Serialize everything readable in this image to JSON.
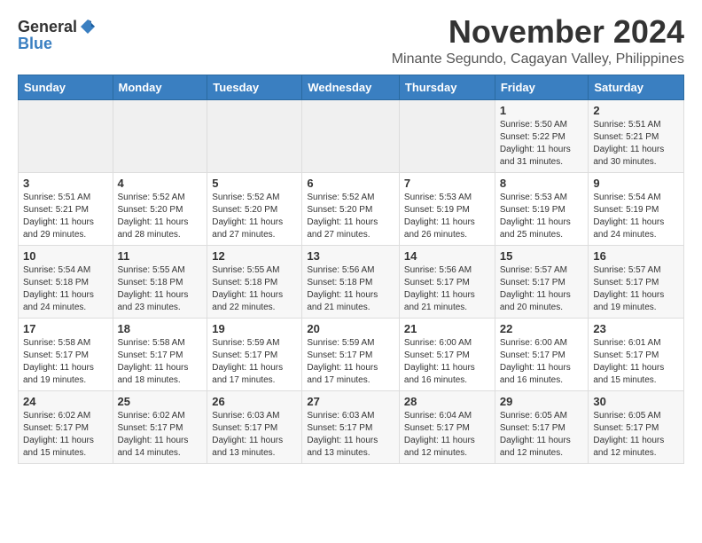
{
  "header": {
    "logo_general": "General",
    "logo_blue": "Blue",
    "month": "November 2024",
    "location": "Minante Segundo, Cagayan Valley, Philippines"
  },
  "weekdays": [
    "Sunday",
    "Monday",
    "Tuesday",
    "Wednesday",
    "Thursday",
    "Friday",
    "Saturday"
  ],
  "weeks": [
    [
      {
        "day": "",
        "info": ""
      },
      {
        "day": "",
        "info": ""
      },
      {
        "day": "",
        "info": ""
      },
      {
        "day": "",
        "info": ""
      },
      {
        "day": "",
        "info": ""
      },
      {
        "day": "1",
        "info": "Sunrise: 5:50 AM\nSunset: 5:22 PM\nDaylight: 11 hours\nand 31 minutes."
      },
      {
        "day": "2",
        "info": "Sunrise: 5:51 AM\nSunset: 5:21 PM\nDaylight: 11 hours\nand 30 minutes."
      }
    ],
    [
      {
        "day": "3",
        "info": "Sunrise: 5:51 AM\nSunset: 5:21 PM\nDaylight: 11 hours\nand 29 minutes."
      },
      {
        "day": "4",
        "info": "Sunrise: 5:52 AM\nSunset: 5:20 PM\nDaylight: 11 hours\nand 28 minutes."
      },
      {
        "day": "5",
        "info": "Sunrise: 5:52 AM\nSunset: 5:20 PM\nDaylight: 11 hours\nand 27 minutes."
      },
      {
        "day": "6",
        "info": "Sunrise: 5:52 AM\nSunset: 5:20 PM\nDaylight: 11 hours\nand 27 minutes."
      },
      {
        "day": "7",
        "info": "Sunrise: 5:53 AM\nSunset: 5:19 PM\nDaylight: 11 hours\nand 26 minutes."
      },
      {
        "day": "8",
        "info": "Sunrise: 5:53 AM\nSunset: 5:19 PM\nDaylight: 11 hours\nand 25 minutes."
      },
      {
        "day": "9",
        "info": "Sunrise: 5:54 AM\nSunset: 5:19 PM\nDaylight: 11 hours\nand 24 minutes."
      }
    ],
    [
      {
        "day": "10",
        "info": "Sunrise: 5:54 AM\nSunset: 5:18 PM\nDaylight: 11 hours\nand 24 minutes."
      },
      {
        "day": "11",
        "info": "Sunrise: 5:55 AM\nSunset: 5:18 PM\nDaylight: 11 hours\nand 23 minutes."
      },
      {
        "day": "12",
        "info": "Sunrise: 5:55 AM\nSunset: 5:18 PM\nDaylight: 11 hours\nand 22 minutes."
      },
      {
        "day": "13",
        "info": "Sunrise: 5:56 AM\nSunset: 5:18 PM\nDaylight: 11 hours\nand 21 minutes."
      },
      {
        "day": "14",
        "info": "Sunrise: 5:56 AM\nSunset: 5:17 PM\nDaylight: 11 hours\nand 21 minutes."
      },
      {
        "day": "15",
        "info": "Sunrise: 5:57 AM\nSunset: 5:17 PM\nDaylight: 11 hours\nand 20 minutes."
      },
      {
        "day": "16",
        "info": "Sunrise: 5:57 AM\nSunset: 5:17 PM\nDaylight: 11 hours\nand 19 minutes."
      }
    ],
    [
      {
        "day": "17",
        "info": "Sunrise: 5:58 AM\nSunset: 5:17 PM\nDaylight: 11 hours\nand 19 minutes."
      },
      {
        "day": "18",
        "info": "Sunrise: 5:58 AM\nSunset: 5:17 PM\nDaylight: 11 hours\nand 18 minutes."
      },
      {
        "day": "19",
        "info": "Sunrise: 5:59 AM\nSunset: 5:17 PM\nDaylight: 11 hours\nand 17 minutes."
      },
      {
        "day": "20",
        "info": "Sunrise: 5:59 AM\nSunset: 5:17 PM\nDaylight: 11 hours\nand 17 minutes."
      },
      {
        "day": "21",
        "info": "Sunrise: 6:00 AM\nSunset: 5:17 PM\nDaylight: 11 hours\nand 16 minutes."
      },
      {
        "day": "22",
        "info": "Sunrise: 6:00 AM\nSunset: 5:17 PM\nDaylight: 11 hours\nand 16 minutes."
      },
      {
        "day": "23",
        "info": "Sunrise: 6:01 AM\nSunset: 5:17 PM\nDaylight: 11 hours\nand 15 minutes."
      }
    ],
    [
      {
        "day": "24",
        "info": "Sunrise: 6:02 AM\nSunset: 5:17 PM\nDaylight: 11 hours\nand 15 minutes."
      },
      {
        "day": "25",
        "info": "Sunrise: 6:02 AM\nSunset: 5:17 PM\nDaylight: 11 hours\nand 14 minutes."
      },
      {
        "day": "26",
        "info": "Sunrise: 6:03 AM\nSunset: 5:17 PM\nDaylight: 11 hours\nand 13 minutes."
      },
      {
        "day": "27",
        "info": "Sunrise: 6:03 AM\nSunset: 5:17 PM\nDaylight: 11 hours\nand 13 minutes."
      },
      {
        "day": "28",
        "info": "Sunrise: 6:04 AM\nSunset: 5:17 PM\nDaylight: 11 hours\nand 12 minutes."
      },
      {
        "day": "29",
        "info": "Sunrise: 6:05 AM\nSunset: 5:17 PM\nDaylight: 11 hours\nand 12 minutes."
      },
      {
        "day": "30",
        "info": "Sunrise: 6:05 AM\nSunset: 5:17 PM\nDaylight: 11 hours\nand 12 minutes."
      }
    ]
  ]
}
